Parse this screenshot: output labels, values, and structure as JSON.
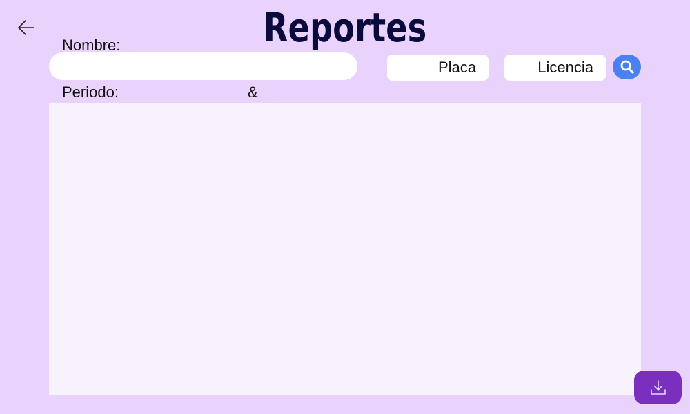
{
  "header": {
    "title": "Reportes",
    "back_icon": "arrow-left-icon"
  },
  "filters": {
    "nombre_label": "Nombre:",
    "nombre_value": "",
    "nombre_placeholder": "",
    "placa_placeholder": "Placa",
    "licencia_placeholder": "Licencia",
    "periodo_label": "Periodo:",
    "periodo_separator": "&",
    "search_icon": "search-icon"
  },
  "results": {
    "items": []
  },
  "actions": {
    "download_icon": "download-icon"
  },
  "colors": {
    "background": "#e9d3fc",
    "title": "#0a0a3c",
    "search_button": "#4a80f0",
    "download_button": "#7b2fbe",
    "panel": "#f8f2fd"
  }
}
